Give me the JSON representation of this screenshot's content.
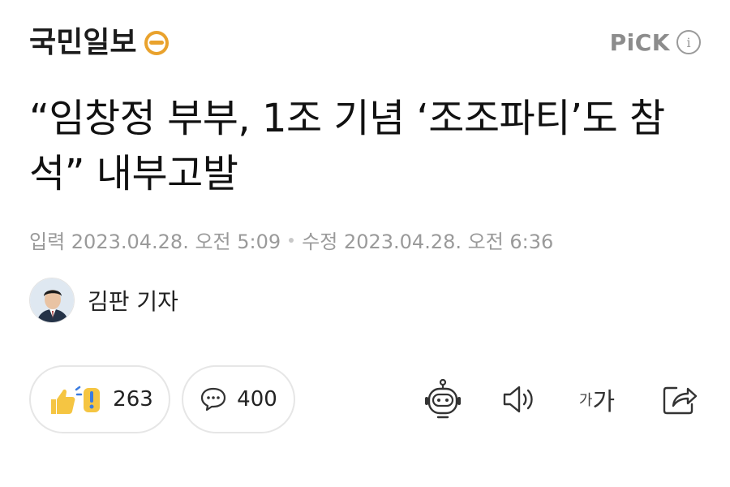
{
  "header": {
    "logo_text": "국민일보",
    "pick_label": "PiCK",
    "info_glyph": "i"
  },
  "article": {
    "headline": "“임창정 부부, 1조 기념 ‘조조파티’도 참석” 내부고발",
    "published": "입력 2023.04.28. 오전 5:09",
    "modified": "수정 2023.04.28. 오전 6:36",
    "reporter": "김판 기자"
  },
  "actions": {
    "reaction_count": "263",
    "comment_count": "400",
    "font_small": "가",
    "font_big": "가"
  },
  "icons": {
    "logo_mark": "smile-badge-icon",
    "reaction": "thumbs-up-exclaim-icon",
    "comment": "speech-bubble-icon",
    "bot": "robot-icon",
    "sound": "speaker-icon",
    "share": "share-arrow-icon"
  },
  "colors": {
    "logo_orange": "#E9A22D",
    "text_muted": "#9A9A9A",
    "reaction_yellow": "#F5C542",
    "reaction_blue": "#3A7BE0"
  }
}
